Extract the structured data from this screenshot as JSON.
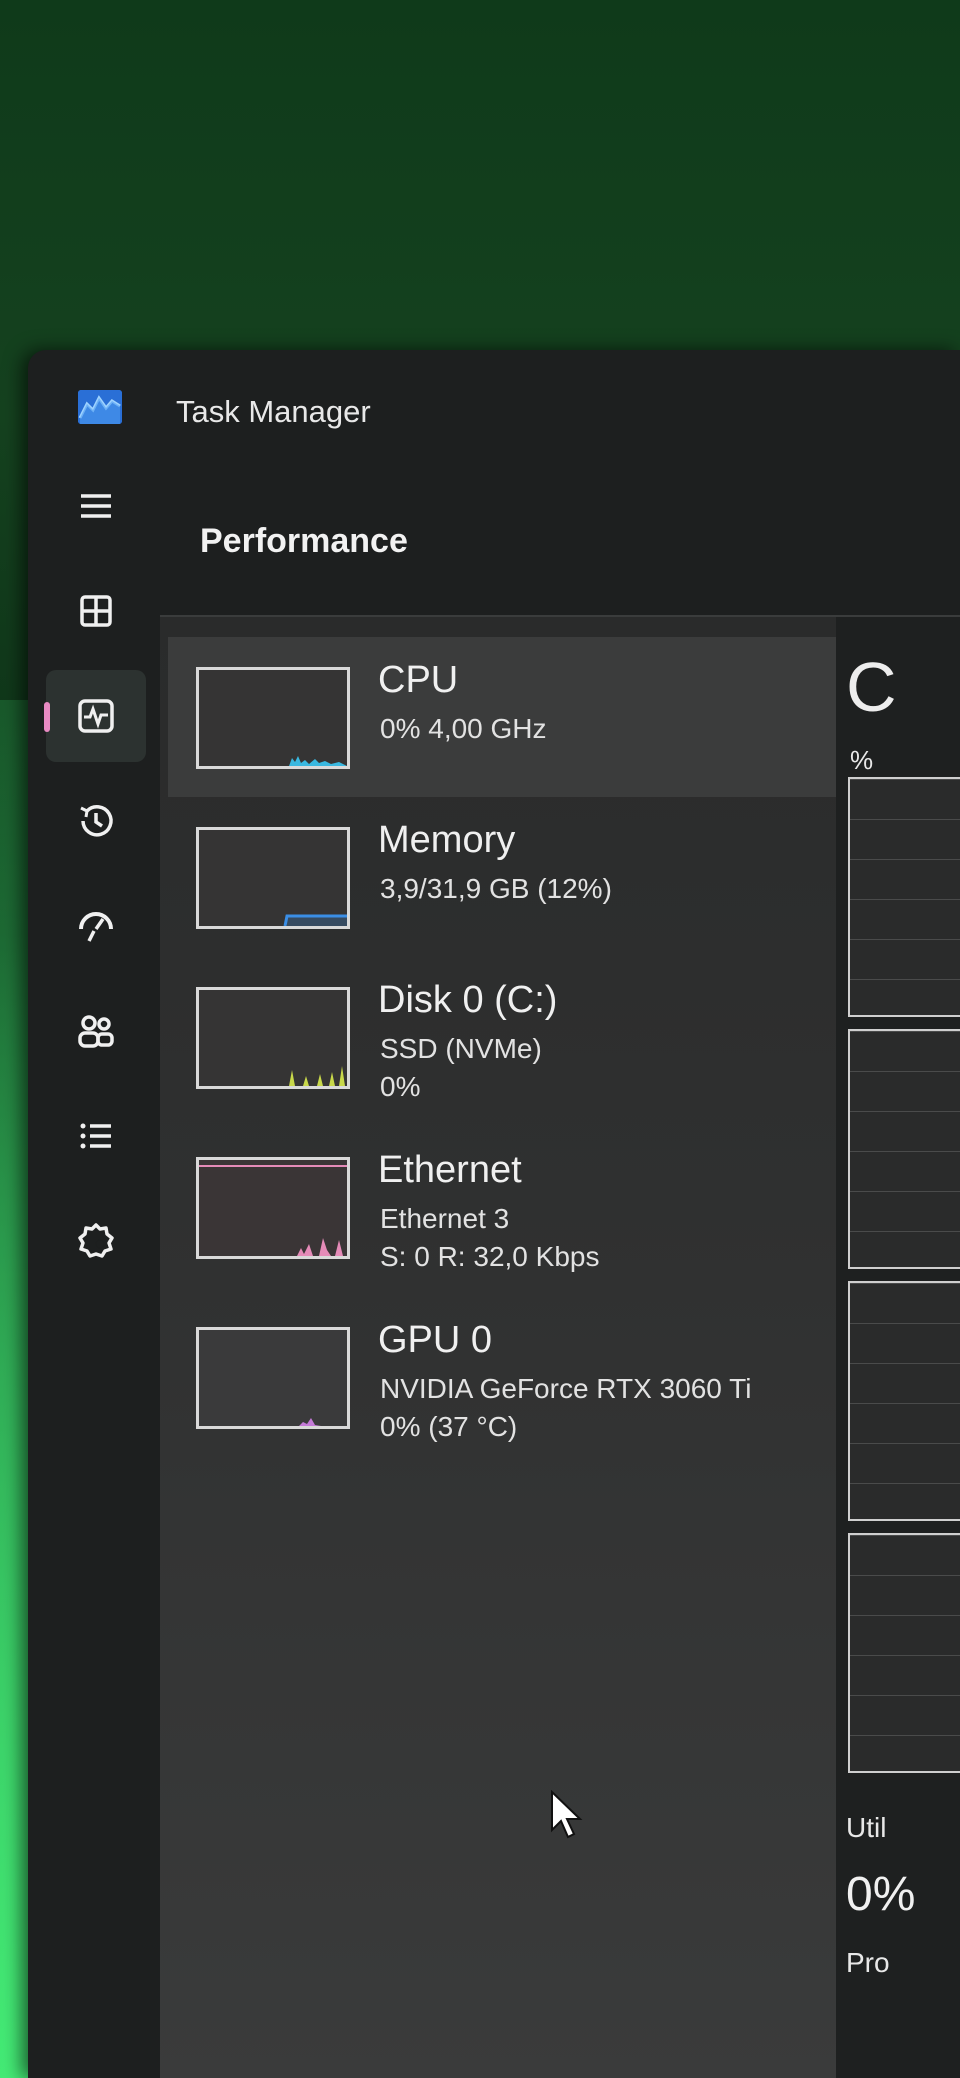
{
  "window": {
    "title": "Task Manager"
  },
  "nav": {
    "items": [
      {
        "name": "hamburger-menu-icon"
      },
      {
        "name": "processes-icon"
      },
      {
        "name": "performance-icon",
        "active": true
      },
      {
        "name": "app-history-icon"
      },
      {
        "name": "startup-apps-icon"
      },
      {
        "name": "users-icon"
      },
      {
        "name": "details-icon"
      },
      {
        "name": "services-icon"
      }
    ]
  },
  "page": {
    "title": "Performance"
  },
  "perf_items": [
    {
      "title": "CPU",
      "line1": "0% 4,00 GHz",
      "line2": "",
      "graph_color": "#39b8e0",
      "selected": true
    },
    {
      "title": "Memory",
      "line1": "3,9/31,9 GB (12%)",
      "line2": "",
      "graph_color": "#3a8ee6"
    },
    {
      "title": "Disk 0 (C:)",
      "line1": "SSD (NVMe)",
      "line2": "0%",
      "graph_color": "#c8d84a"
    },
    {
      "title": "Ethernet",
      "line1": "Ethernet 3",
      "line2": "S: 0 R: 32,0 Kbps",
      "graph_color": "#e58bb8"
    },
    {
      "title": "GPU 0",
      "line1": "NVIDIA GeForce RTX 3060 Ti",
      "line2": "0% (37 °C)",
      "graph_color": "#c47ad8"
    }
  ],
  "detail_panel": {
    "heading_partial": "C",
    "percent_label": "%",
    "utilization_label_partial": "Util",
    "utilization_value_partial": "0%",
    "processes_label_partial": "Pro"
  }
}
